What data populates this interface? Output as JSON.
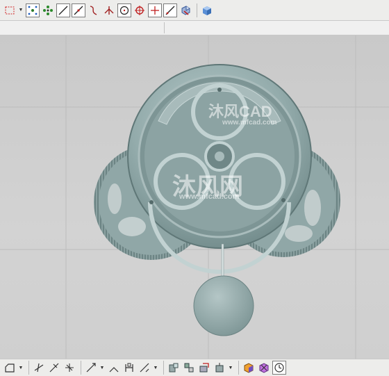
{
  "top_toolbar": {
    "icons": [
      "select-rectangle-icon",
      "snap-point-icon",
      "snap-grid-icon",
      "line-icon",
      "line-tangent-icon",
      "spline-curve-icon",
      "intersection-icon",
      "circle-icon",
      "center-point-icon",
      "crosshair-icon",
      "diagonal-line-icon",
      "view-orient-icon",
      "shaded-cube-icon"
    ]
  },
  "bottom_toolbar": {
    "icons": [
      "sketch-shape-icon",
      "trim-icon",
      "extend-icon",
      "offset-icon",
      "fillet-icon",
      "chamfer-icon",
      "dimension-icon",
      "constraint-icon",
      "relation-icon",
      "assembly-icon",
      "component-icon",
      "move-icon",
      "render-icon",
      "render-options-icon",
      "clock-icon"
    ]
  },
  "viewport": {
    "background_color": "#cdcdcd",
    "model_color": "#8fa6a6",
    "model": "pendulum-clock-gear-assembly"
  },
  "watermark": {
    "large_brand": "沐风网",
    "large_url": "www.mfcad.com",
    "small_brand": "沐风CAD",
    "small_url": "www.mfcad.com"
  }
}
